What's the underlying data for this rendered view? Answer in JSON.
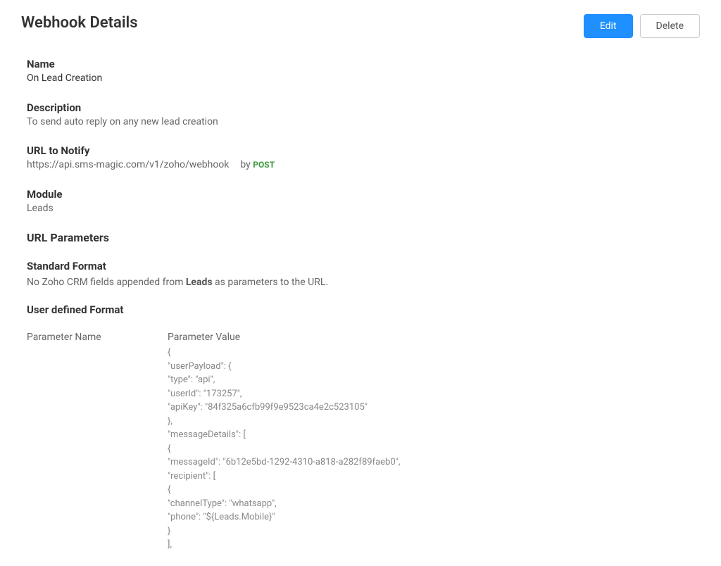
{
  "page": {
    "title": "Webhook Details",
    "buttons": {
      "edit": "Edit",
      "delete": "Delete"
    }
  },
  "fields": {
    "name": {
      "label": "Name",
      "value": "On Lead Creation"
    },
    "description": {
      "label": "Description",
      "value": "To send auto reply on any new lead creation"
    },
    "url": {
      "label": "URL to Notify",
      "value": "https://api.sms-magic.com/v1/zoho/webhook",
      "by_label": "by",
      "method": "POST"
    },
    "module": {
      "label": "Module",
      "value": "Leads"
    }
  },
  "sections": {
    "url_params": "URL Parameters",
    "standard_format": {
      "heading": "Standard Format",
      "text_prefix": "No Zoho CRM fields appended from ",
      "text_bold": "Leads",
      "text_suffix": " as parameters to the URL."
    },
    "user_defined": {
      "heading": "User defined Format",
      "col_name": "Parameter Name",
      "col_value": "Parameter Value"
    }
  },
  "payload_text": "{\n\"userPayload\": {\n\"type\": \"api\",\n\"userId\": \"173257\",\n\"apiKey\": \"84f325a6cfb99f9e9523ca4e2c523105\"\n},\n\"messageDetails\": [\n{\n\"messageId\": \"6b12e5bd-1292-4310-a818-a282f89faeb0\",\n\"recipient\": [\n{\n\"channelType\": \"whatsapp\",\n\"phone\": \"${Leads.Mobile}\"\n}\n],"
}
